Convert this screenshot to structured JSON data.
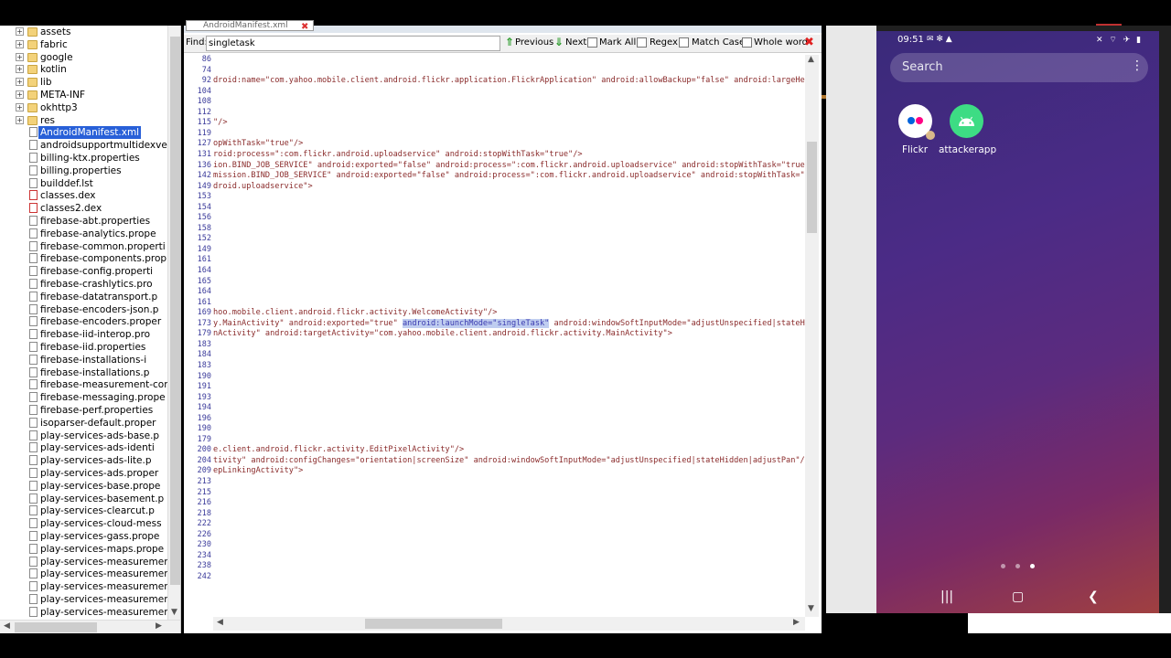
{
  "tree": {
    "items": [
      {
        "label": "assets",
        "type": "folder",
        "expand": "+"
      },
      {
        "label": "fabric",
        "type": "folder",
        "expand": "+"
      },
      {
        "label": "google",
        "type": "folder",
        "expand": "+"
      },
      {
        "label": "kotlin",
        "type": "folder",
        "expand": "+"
      },
      {
        "label": "lib",
        "type": "folder",
        "expand": "+"
      },
      {
        "label": "META-INF",
        "type": "folder",
        "expand": "+"
      },
      {
        "label": "okhttp3",
        "type": "folder",
        "expand": "+"
      },
      {
        "label": "res",
        "type": "folder",
        "expand": "+"
      },
      {
        "label": "AndroidManifest.xml",
        "type": "file",
        "selected": true
      },
      {
        "label": "androidsupportmultidexve",
        "type": "file"
      },
      {
        "label": "billing-ktx.properties",
        "type": "file"
      },
      {
        "label": "billing.properties",
        "type": "file"
      },
      {
        "label": "builddef.lst",
        "type": "file"
      },
      {
        "label": "classes.dex",
        "type": "dex"
      },
      {
        "label": "classes2.dex",
        "type": "dex"
      },
      {
        "label": "firebase-abt.properties",
        "type": "file"
      },
      {
        "label": "firebase-analytics.prope",
        "type": "file"
      },
      {
        "label": "firebase-common.properti",
        "type": "file"
      },
      {
        "label": "firebase-components.prop",
        "type": "file"
      },
      {
        "label": "firebase-config.properti",
        "type": "file"
      },
      {
        "label": "firebase-crashlytics.pro",
        "type": "file"
      },
      {
        "label": "firebase-datatransport.p",
        "type": "file"
      },
      {
        "label": "firebase-encoders-json.p",
        "type": "file"
      },
      {
        "label": "firebase-encoders.proper",
        "type": "file"
      },
      {
        "label": "firebase-iid-interop.pro",
        "type": "file"
      },
      {
        "label": "firebase-iid.properties",
        "type": "file"
      },
      {
        "label": "firebase-installations-i",
        "type": "file"
      },
      {
        "label": "firebase-installations.p",
        "type": "file"
      },
      {
        "label": "firebase-measurement-con",
        "type": "file"
      },
      {
        "label": "firebase-messaging.prope",
        "type": "file"
      },
      {
        "label": "firebase-perf.properties",
        "type": "file"
      },
      {
        "label": "isoparser-default.proper",
        "type": "file"
      },
      {
        "label": "play-services-ads-base.p",
        "type": "file"
      },
      {
        "label": "play-services-ads-identi",
        "type": "file"
      },
      {
        "label": "play-services-ads-lite.p",
        "type": "file"
      },
      {
        "label": "play-services-ads.proper",
        "type": "file"
      },
      {
        "label": "play-services-base.prope",
        "type": "file"
      },
      {
        "label": "play-services-basement.p",
        "type": "file"
      },
      {
        "label": "play-services-clearcut.p",
        "type": "file"
      },
      {
        "label": "play-services-cloud-mess",
        "type": "file"
      },
      {
        "label": "play-services-gass.prope",
        "type": "file"
      },
      {
        "label": "play-services-maps.prope",
        "type": "file"
      },
      {
        "label": "play-services-measuremen",
        "type": "file"
      },
      {
        "label": "play-services-measuremen",
        "type": "file"
      },
      {
        "label": "play-services-measuremen",
        "type": "file"
      },
      {
        "label": "play-services-measuremen",
        "type": "file"
      },
      {
        "label": "play-services-measuremen",
        "type": "file"
      }
    ]
  },
  "editor": {
    "tab_label": "AndroidManifest.xml",
    "find": {
      "label": "Find:",
      "value": "singletask",
      "previous": "Previous",
      "next": "Next",
      "mark_all": "Mark All",
      "regex": "Regex",
      "match_case": "Match Case",
      "whole_word": "Whole word"
    },
    "lines": [
      {
        "num": "86",
        "code": ""
      },
      {
        "num": "74",
        "code": ""
      },
      {
        "num": "92",
        "code": "droid:name=\"com.yahoo.mobile.client.android.flickr.application.FlickrApplication\" android:allowBackup=\"false\" android:largeHeap="
      },
      {
        "num": "104",
        "code": ""
      },
      {
        "num": "108",
        "code": ""
      },
      {
        "num": "112",
        "code": ""
      },
      {
        "num": "115",
        "code": "\"/>"
      },
      {
        "num": "119",
        "code": ""
      },
      {
        "num": "127",
        "code": "opWithTask=\"true\"/>"
      },
      {
        "num": "131",
        "code": "roid:process=\":com.flickr.android.uploadservice\" android:stopWithTask=\"true\"/>"
      },
      {
        "num": "136",
        "code": "ion.BIND_JOB_SERVICE\" android:exported=\"false\" android:process=\":com.flickr.android.uploadservice\" android:stopWithTask=\"true\"/>"
      },
      {
        "num": "142",
        "code": "mission.BIND_JOB_SERVICE\" android:exported=\"false\" android:process=\":com.flickr.android.uploadservice\" android:stopWithTask=\"tru"
      },
      {
        "num": "149",
        "code": "droid.uploadservice\">"
      },
      {
        "num": "153",
        "code": ""
      },
      {
        "num": "154",
        "code": ""
      },
      {
        "num": "156",
        "code": ""
      },
      {
        "num": "158",
        "code": ""
      },
      {
        "num": "152",
        "code": ""
      },
      {
        "num": "149",
        "code": ""
      },
      {
        "num": "161",
        "code": ""
      },
      {
        "num": "164",
        "code": ""
      },
      {
        "num": "165",
        "code": ""
      },
      {
        "num": "164",
        "code": ""
      },
      {
        "num": "161",
        "code": ""
      },
      {
        "num": "169",
        "code": "hoo.mobile.client.android.flickr.activity.WelcomeActivity\"/>"
      },
      {
        "num": "173",
        "code": "y.MainActivity\" android:exported=\"true\" ",
        "highlight": "android:launchMode=\"singleTask\"",
        "rest": " android:windowSoftInputMode=\"adjustUnspecified|stateHidd"
      },
      {
        "num": "179",
        "code": "nActivity\" android:targetActivity=\"com.yahoo.mobile.client.android.flickr.activity.MainActivity\">"
      },
      {
        "num": "183",
        "code": ""
      },
      {
        "num": "184",
        "code": ""
      },
      {
        "num": "183",
        "code": ""
      },
      {
        "num": "190",
        "code": ""
      },
      {
        "num": "191",
        "code": ""
      },
      {
        "num": "193",
        "code": ""
      },
      {
        "num": "194",
        "code": ""
      },
      {
        "num": "196",
        "code": ""
      },
      {
        "num": "190",
        "code": ""
      },
      {
        "num": "179",
        "code": ""
      },
      {
        "num": "200",
        "code": "e.client.android.flickr.activity.EditPixelActivity\"/>"
      },
      {
        "num": "204",
        "code": "tivity\" android:configChanges=\"orientation|screenSize\" android:windowSoftInputMode=\"adjustUnspecified|stateHidden|adjustPan\"/>"
      },
      {
        "num": "209",
        "code": "epLinkingActivity\">"
      },
      {
        "num": "213",
        "code": ""
      },
      {
        "num": "215",
        "code": ""
      },
      {
        "num": "216",
        "code": ""
      },
      {
        "num": "218",
        "code": ""
      },
      {
        "num": "222",
        "code": ""
      },
      {
        "num": "226",
        "code": ""
      },
      {
        "num": "230",
        "code": ""
      },
      {
        "num": "234",
        "code": ""
      },
      {
        "num": "238",
        "code": ""
      },
      {
        "num": "242",
        "code": ""
      }
    ]
  },
  "phone": {
    "time": "09:51",
    "status_left": "✉ ✻ ▲",
    "status_right": "✕ ⌔ ✈ ▮",
    "search_placeholder": "Search",
    "apps": [
      {
        "label": "Flickr"
      },
      {
        "label": "attackerapp"
      }
    ]
  },
  "colors": {
    "selection": "#2860d8",
    "highlight": "#bfcdf0",
    "code_text": "#8a2b2b",
    "line_numbers": "#3a3a9a",
    "flickr_pink": "#ff0084",
    "flickr_blue": "#0063dc",
    "android_green": "#3ddc84"
  }
}
